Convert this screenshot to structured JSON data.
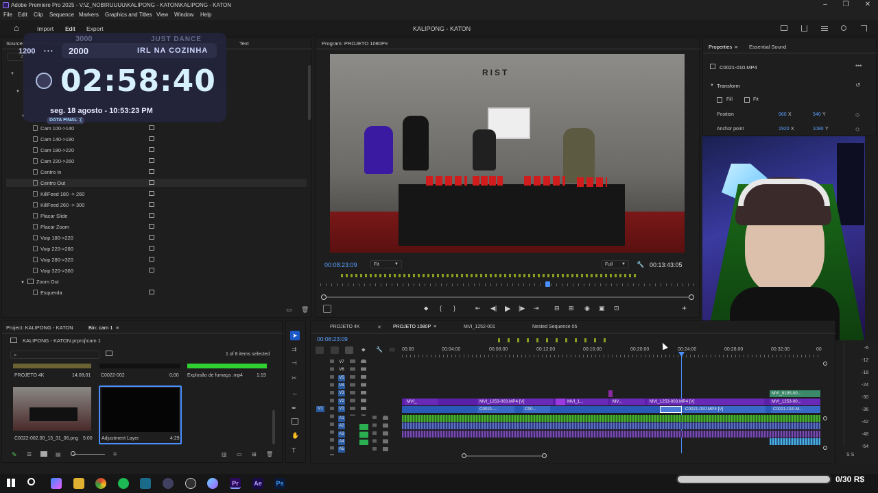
{
  "window": {
    "title": "Adobe Premiere Pro 2025 - V:\\Z_NOBIRUUUU\\KALIPONG - KATON\\KALIPONG - KATON",
    "minimize": "–",
    "maximize": "❐",
    "close": "✕"
  },
  "menu": [
    "File",
    "Edit",
    "Clip",
    "Sequence",
    "Markers",
    "Graphics and Titles",
    "View",
    "Window",
    "Help"
  ],
  "header": {
    "home": "⌂",
    "import": "Import",
    "edit": "Edit",
    "export": "Export",
    "project_title": "KALIPONG - KATON"
  },
  "source_panel": {
    "tab_source": "Source: PROJETO 1080P",
    "tab_effects": "ects",
    "tab_text": "Text",
    "search_placeholder": "ZO",
    "tree_items": [
      "Cam 100->140",
      "Cam 140->180",
      "Cam 180->220",
      "Cam 220->260",
      "Centro In",
      "Centro Out",
      "KillFeed 180 -> 260",
      "KillFeed 260 -> 300",
      "Placar Slide",
      "Placar Zoom",
      "Voip 180->220",
      "Voip 220->280",
      "Voip 280->320",
      "Voip 320->360"
    ],
    "folder_zoom_out": "Zoom Out",
    "item_esquerda": "Esquerda"
  },
  "overlay": {
    "score_top_left": "3000",
    "score_top_right": "JUST DANCE",
    "score_left": "1200",
    "score_dots": "• • •",
    "score_main": "2000",
    "score_main_label": "IRL NA COZINHA",
    "timer": "02:58:40",
    "date": "seg. 18 agosto - 10:53:23 PM",
    "badge": "DATA FINAL :("
  },
  "program": {
    "tab": "Program: PROJETO 1080P",
    "timecode": "00:08:23:09",
    "fit": "Fit",
    "quality": "Full",
    "duration": "00:13:43:05",
    "scene_sign": "RIST"
  },
  "properties": {
    "tab": "Properties",
    "tab_sound": "Essential Sound",
    "clip_name": "C0021-010.MP4",
    "transform": "Transform",
    "fill": "Fill",
    "fit": "Fit",
    "position_label": "Position",
    "position_x": "960",
    "position_y": "540",
    "anchor_label": "Anchor point",
    "anchor_x": "1920",
    "anchor_y": "1080",
    "x_unit": "X",
    "y_unit": "Y"
  },
  "project_panel": {
    "tab_project": "Project: KALIPONG - KATON",
    "tab_bin": "Bin: cam 1",
    "file_name": "KALIPONG - KATON.prproj\\cam 1",
    "items_selected": "1 of 8 items selected",
    "items": [
      {
        "name": "PROJETO 4K",
        "duration": "14;08;01"
      },
      {
        "name": "C0022-002",
        "duration": "0;00"
      },
      {
        "name": "Explosão de fumaça .mp4",
        "duration": "1:19"
      },
      {
        "name": "C0022-002.00_13_31_06.png",
        "duration": "5:00"
      },
      {
        "name": "Adjustment Layer",
        "duration": "4:29"
      }
    ]
  },
  "timeline": {
    "tabs": [
      "PROJETO 4K",
      "PROJETO 1080P",
      "MVI_1252-001",
      "Nested Sequence 05"
    ],
    "timecode": "00:08:23:09",
    "ruler": [
      "00:00",
      "00:04:00",
      "00:08:00",
      "00:12:00",
      "00:16:00",
      "00:20:00",
      "00:24:00",
      "00:28:00",
      "00:32:00",
      "00"
    ],
    "video_tracks": [
      "V7",
      "V6",
      "V5",
      "V4",
      "V3",
      "V2",
      "V1"
    ],
    "audio_tracks": [
      "A1",
      "A2",
      "A3",
      "A4",
      "A5"
    ],
    "v2_clips": [
      "MVI_",
      "MVI_1253-003.MP4 [V]",
      "MVI_1...",
      "MV...",
      "MVI_1253-003.MP4 [V]",
      "MVI_1253-00..."
    ],
    "v1_clips": [
      "C0021-...",
      "C00...",
      "C0021-010.MP4 [V]",
      "C0021-010.M..."
    ],
    "v3_clip": "MVI_8195-00...",
    "meter_labels": [
      "-6",
      "-12",
      "-18",
      "-24",
      "-30",
      "-36",
      "-42",
      "-48",
      "-54"
    ],
    "meter_bottom": "S  S"
  },
  "taskbar": {
    "price": "0/30 R$"
  }
}
